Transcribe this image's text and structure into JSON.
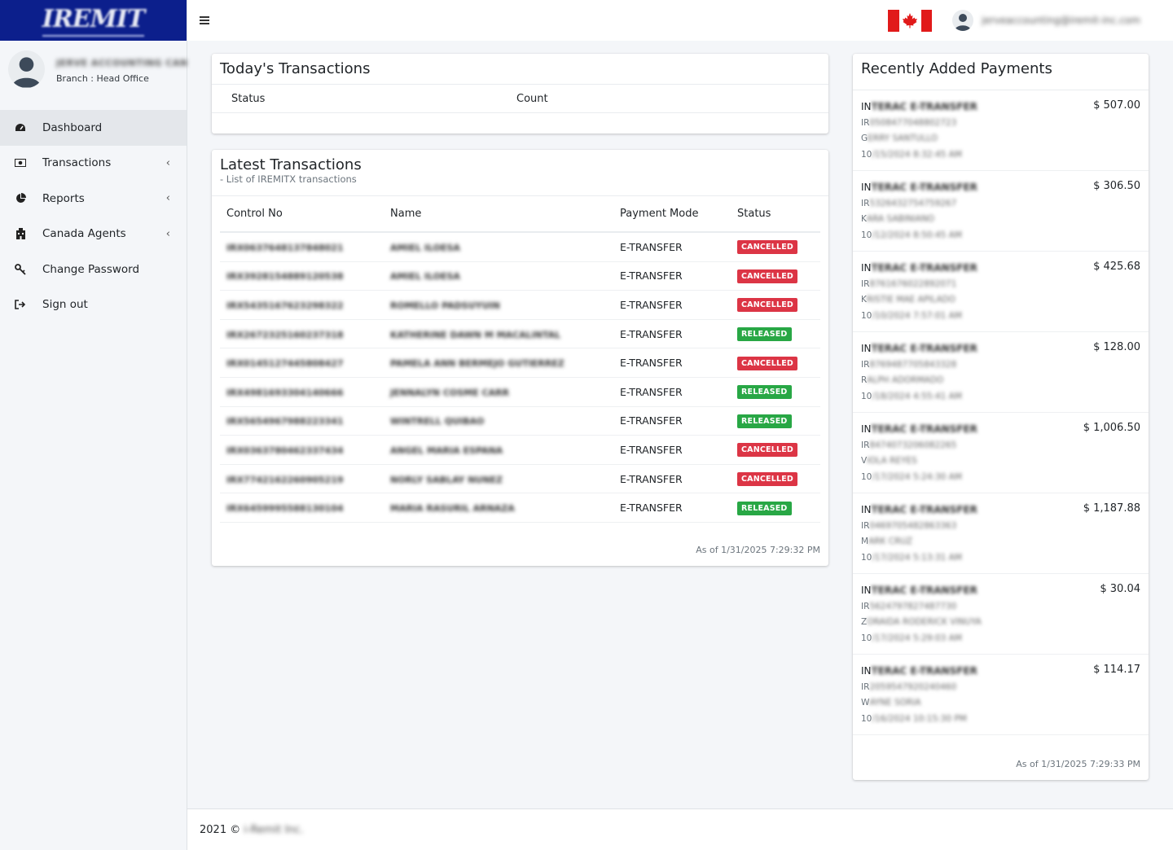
{
  "brand": {
    "logo_text": "IREMIT",
    "color": "#0c1f8c"
  },
  "user": {
    "name": "JERVE ACCOUNTING CAN",
    "branch": "Branch : Head Office",
    "email": "jerveaccounting@iremit-inc.com"
  },
  "nav": [
    {
      "label": "Dashboard",
      "icon": "dashboard-icon",
      "has_submenu": false,
      "active": true
    },
    {
      "label": "Transactions",
      "icon": "money-icon",
      "has_submenu": true,
      "active": false
    },
    {
      "label": "Reports",
      "icon": "pie-chart-icon",
      "has_submenu": true,
      "active": false
    },
    {
      "label": "Canada Agents",
      "icon": "building-icon",
      "has_submenu": true,
      "active": false
    },
    {
      "label": "Change Password",
      "icon": "key-icon",
      "has_submenu": false,
      "active": false
    },
    {
      "label": "Sign out",
      "icon": "sign-out-icon",
      "has_submenu": false,
      "active": false
    }
  ],
  "topbar": {
    "menu_icon": "hamburger-icon",
    "flag": "canada-flag-icon"
  },
  "today": {
    "title": "Today's Transactions",
    "columns": [
      "Status",
      "Count"
    ]
  },
  "latest": {
    "title": "Latest Transactions",
    "subtitle": "- List of IREMITX transactions",
    "columns": [
      "Control No",
      "Name",
      "Payment Mode",
      "Status"
    ],
    "rows": [
      {
        "control_no": "IRX0637648137848021",
        "name": "AMIEL ILOESA",
        "mode": "E-TRANSFER",
        "status": "CANCELLED"
      },
      {
        "control_no": "IRX3928154889120538",
        "name": "AMIEL ILOESA",
        "mode": "E-TRANSFER",
        "status": "CANCELLED"
      },
      {
        "control_no": "IRX5435167623298322",
        "name": "ROMELLO PADSUYUIN",
        "mode": "E-TRANSFER",
        "status": "CANCELLED"
      },
      {
        "control_no": "IRX2672325160237318",
        "name": "KATHERINE DAWN M MACALINTAL",
        "mode": "E-TRANSFER",
        "status": "RELEASED"
      },
      {
        "control_no": "IRX0145127445808427",
        "name": "PAMELA ANN BERMEJO GUTIERREZ",
        "mode": "E-TRANSFER",
        "status": "CANCELLED"
      },
      {
        "control_no": "IRX4981693304140666",
        "name": "JENNALYN COSME CARR",
        "mode": "E-TRANSFER",
        "status": "RELEASED"
      },
      {
        "control_no": "IRX5654967988223341",
        "name": "WINTRELL QUIBAO",
        "mode": "E-TRANSFER",
        "status": "RELEASED"
      },
      {
        "control_no": "IRX0363780462337434",
        "name": "ANGEL MARIA ESPANA",
        "mode": "E-TRANSFER",
        "status": "CANCELLED"
      },
      {
        "control_no": "IRX7742162260905219",
        "name": "NORLY SABLAY NUNEZ",
        "mode": "E-TRANSFER",
        "status": "CANCELLED"
      },
      {
        "control_no": "IRX6459995588130104",
        "name": "MARIA RASURIL ARNAZA",
        "mode": "E-TRANSFER",
        "status": "RELEASED"
      }
    ],
    "as_of": "As of 1/31/2025 7:29:32 PM"
  },
  "payments": {
    "title": "Recently Added Payments",
    "items": [
      {
        "type_start": "IN",
        "type_rest": "TERAC E-TRANSFER",
        "ref_start": "IR",
        "ref_rest": "0508477048802723",
        "name_start": "G",
        "name_rest": "ERRY SANTULLO",
        "date_start": "10",
        "date_rest": "/15/2024 8:32:45 AM",
        "amount": "$ 507.00"
      },
      {
        "type_start": "IN",
        "type_rest": "TERAC E-TRANSFER",
        "ref_start": "IR",
        "ref_rest": "5326432754759267",
        "name_start": "K",
        "name_rest": "ARA SABINIANO",
        "date_start": "10",
        "date_rest": "/12/2024 8:50:45 AM",
        "amount": "$ 306.50"
      },
      {
        "type_start": "IN",
        "type_rest": "TERAC E-TRANSFER",
        "ref_start": "IR",
        "ref_rest": "8761676022892071",
        "name_start": "K",
        "name_rest": "RISTIE MAE APILADO",
        "date_start": "10",
        "date_rest": "/10/2024 7:57:01 AM",
        "amount": "$ 425.68"
      },
      {
        "type_start": "IN",
        "type_rest": "TERAC E-TRANSFER",
        "ref_start": "IR",
        "ref_rest": "8769487705843328",
        "name_start": "R",
        "name_rest": "ALPH ADORMADO",
        "date_start": "10",
        "date_rest": "/18/2024 4:55:41 AM",
        "amount": "$ 128.00"
      },
      {
        "type_start": "IN",
        "type_rest": "TERAC E-TRANSFER",
        "ref_start": "IR",
        "ref_rest": "8474073206082265",
        "name_start": "V",
        "name_rest": "IOLA REYES",
        "date_start": "10",
        "date_rest": "/17/2024 5:24:30 AM",
        "amount": "$ 1,006.50"
      },
      {
        "type_start": "IN",
        "type_rest": "TERAC E-TRANSFER",
        "ref_start": "IR",
        "ref_rest": "0469705482863363",
        "name_start": "M",
        "name_rest": "ARK CRUZ",
        "date_start": "10",
        "date_rest": "/17/2024 5:13:31 AM",
        "amount": "$ 1,187.88"
      },
      {
        "type_start": "IN",
        "type_rest": "TERAC E-TRANSFER",
        "ref_start": "IR",
        "ref_rest": "5624797827487730",
        "name_start": "Z",
        "name_rest": "ORAIDA RODERICK VINUYA",
        "date_start": "10",
        "date_rest": "/17/2024 5:29:03 AM",
        "amount": "$ 30.04"
      },
      {
        "type_start": "IN",
        "type_rest": "TERAC E-TRANSFER",
        "ref_start": "IR",
        "ref_rest": "2059547920240460",
        "name_start": "W",
        "name_rest": "AYNE SORIA",
        "date_start": "10",
        "date_rest": "/16/2024 10:15:30 PM",
        "amount": "$ 114.17"
      }
    ],
    "as_of": "As of 1/31/2025 7:29:33 PM"
  },
  "footer": {
    "year_text": "2021 ©",
    "company": "i-Remit Inc."
  },
  "colors": {
    "cancelled": "#dc3545",
    "released": "#28a745",
    "canada_red": "#e11a1a"
  }
}
